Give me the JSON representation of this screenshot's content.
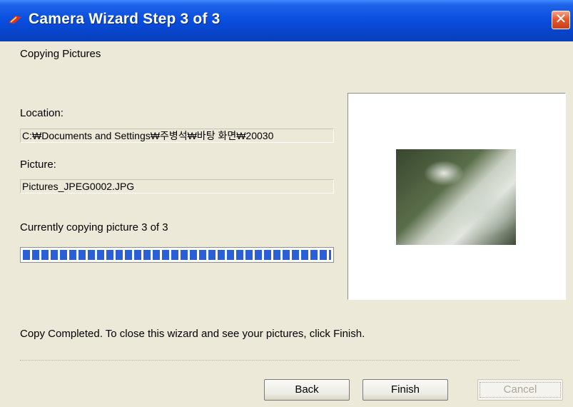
{
  "window": {
    "title": "Camera Wizard Step 3 of 3",
    "close_glyph": "✕"
  },
  "page": {
    "heading": "Copying Pictures"
  },
  "location": {
    "label": "Location:",
    "value": "C:₩Documents and Settings₩주병석₩바탕 화면₩20030"
  },
  "picture": {
    "label": "Picture:",
    "value": "Pictures_JPEG0002.JPG"
  },
  "progress": {
    "status": "Currently copying picture 3 of 3",
    "fraction": 1.0
  },
  "message": "Copy Completed.  To close this wizard and see your pictures, click Finish.",
  "buttons": {
    "back": "Back",
    "finish": "Finish",
    "cancel": "Cancel"
  },
  "icons": {
    "title": "camera-wizard-icon",
    "close": "close-icon"
  }
}
